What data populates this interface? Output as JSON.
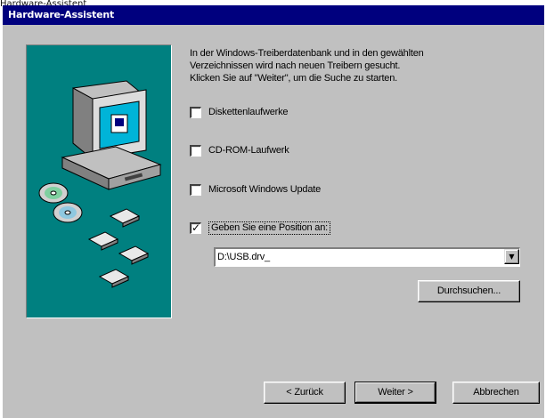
{
  "page_caption": "Hardware-Assistent",
  "window": {
    "title": "Hardware-Assistent"
  },
  "intro_text": "In der Windows-Treiberdatenbank und in den gewählten\nVerzeichnissen wird nach neuen Treibern gesucht.\nKlicken Sie auf \"Weiter\", um die Suche zu starten.",
  "options": [
    {
      "label": "Diskettenlaufwerke",
      "checked": false
    },
    {
      "label": "CD-ROM-Laufwerk",
      "checked": false
    },
    {
      "label": "Microsoft Windows Update",
      "checked": false
    },
    {
      "label": "Geben Sie eine Position an:",
      "checked": true
    }
  ],
  "path_field": {
    "value": "D:\\USB.drv_",
    "dropdown_glyph": "▼"
  },
  "buttons": {
    "browse": "Durchsuchen...",
    "back": "< Zurück",
    "next": "Weiter >",
    "cancel": "Abbrechen"
  },
  "check_glyph": "✓",
  "colors": {
    "titlebar": "#00007e",
    "side_panel": "#008080",
    "dialog_face": "#c0c0c0"
  }
}
